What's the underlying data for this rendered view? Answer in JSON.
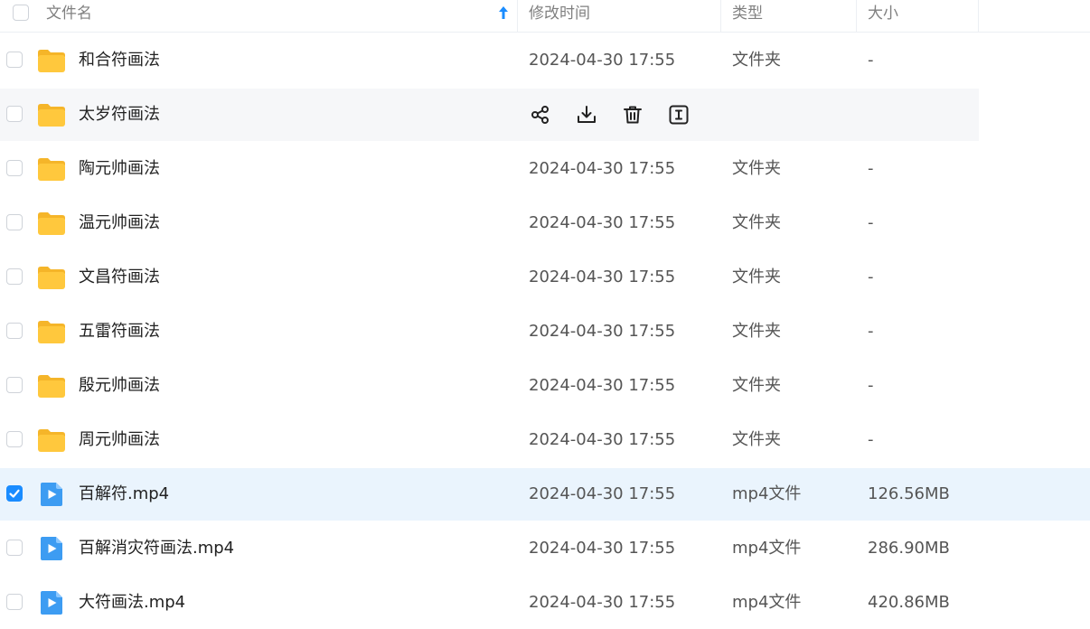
{
  "header": {
    "name": "文件名",
    "modified": "修改时间",
    "type": "类型",
    "size": "大小"
  },
  "icons": {
    "folder": "folder-icon",
    "video": "video-file-icon",
    "share": "share-icon",
    "download": "download-icon",
    "delete": "trash-icon",
    "rename": "rename-icon",
    "sort": "sort-ascending-icon"
  },
  "colors": {
    "accent": "#1a8cff",
    "folder": "#ffc83d",
    "video": "#3d9cf2",
    "selected_row": "#eaf4fd",
    "hover_row": "#f6f7f9"
  },
  "rows": [
    {
      "name": "和合符画法",
      "date": "2024-04-30 17:55",
      "type": "文件夹",
      "size": "-"
    },
    {
      "name": "太岁符画法",
      "date": "",
      "type": "",
      "size": ""
    },
    {
      "name": "陶元帅画法",
      "date": "2024-04-30 17:55",
      "type": "文件夹",
      "size": "-"
    },
    {
      "name": "温元帅画法",
      "date": "2024-04-30 17:55",
      "type": "文件夹",
      "size": "-"
    },
    {
      "name": "文昌符画法",
      "date": "2024-04-30 17:55",
      "type": "文件夹",
      "size": "-"
    },
    {
      "name": "五雷符画法",
      "date": "2024-04-30 17:55",
      "type": "文件夹",
      "size": "-"
    },
    {
      "name": "殷元帅画法",
      "date": "2024-04-30 17:55",
      "type": "文件夹",
      "size": "-"
    },
    {
      "name": "周元帅画法",
      "date": "2024-04-30 17:55",
      "type": "文件夹",
      "size": "-"
    },
    {
      "name": "百解符.mp4",
      "date": "2024-04-30 17:55",
      "type": "mp4文件",
      "size": "126.56MB"
    },
    {
      "name": "百解消灾符画法.mp4",
      "date": "2024-04-30 17:55",
      "type": "mp4文件",
      "size": "286.90MB"
    },
    {
      "name": "大符画法.mp4",
      "date": "2024-04-30 17:55",
      "type": "mp4文件",
      "size": "420.86MB"
    }
  ]
}
